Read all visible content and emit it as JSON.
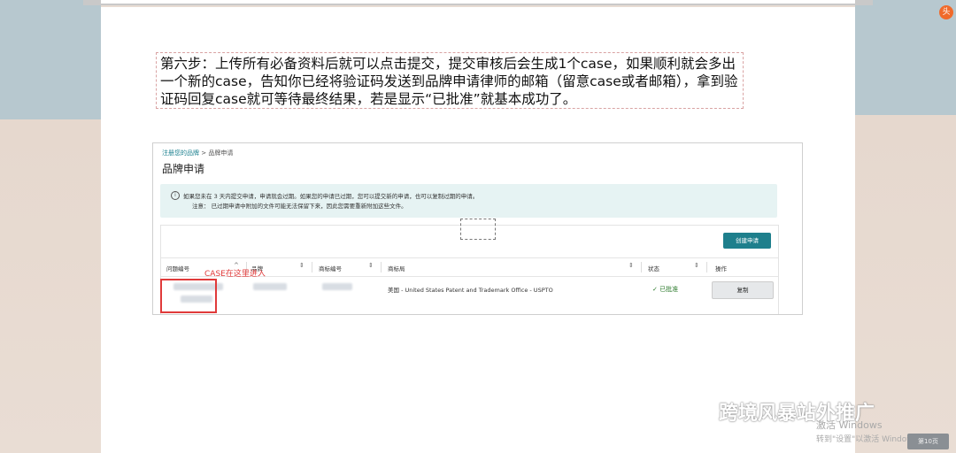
{
  "step_text": "第六步：上传所有必备资料后就可以点击提交，提交审核后会生成1个case，如果顺利就会多出一个新的case，告知你已经将验证码发送到品牌申请律师的邮箱（留意case或者邮箱），拿到验证码回复case就可等待最终结果，若是显示“已批准”就基本成功了。",
  "screenshot": {
    "breadcrumb_link": "注册您的品牌",
    "breadcrumb_sep": ">",
    "breadcrumb_current": "品牌申请",
    "title": "品牌申请",
    "notice_line1": "如果您未在 3 天内提交申请，申请就会过期。如果您的申请已过期，您可以提交新的申请，也可以复制过期的申请。",
    "notice_line2": "注意：  已过期申请中附加的文件可能无法保留下来，因此您需要重新附加这些文件。",
    "create_button": "创建申请",
    "columns": [
      "问题编号",
      "品牌",
      "商标编号",
      "商标局",
      "状态",
      "操作"
    ],
    "row": {
      "trademark_office": "美国 - United States Patent and Trademark Office - USPTO",
      "status": "已批准",
      "action": "复制"
    }
  },
  "annotation": "CASE在这里进入",
  "watermark": "跨境风暴站外推广",
  "activate_line1": "激活 Windows",
  "activate_line2": "转到\"设置\"以激活 Windows。",
  "page_button": "第10页",
  "corner_icon": "头"
}
